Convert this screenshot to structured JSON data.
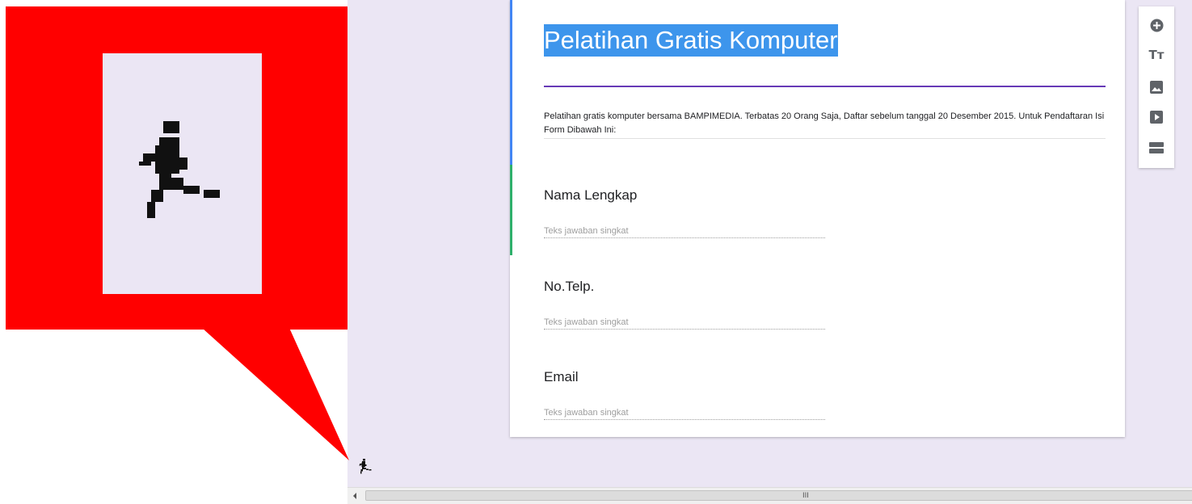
{
  "form": {
    "title": "Pelatihan Gratis Komputer",
    "description": "Pelatihan gratis komputer bersama BAMPIMEDIA. Terbatas 20 Orang Saja, Daftar sebelum tanggal 20 Desember 2015. Untuk Pendaftaran Isi Form Dibawah Ini:",
    "questions": [
      {
        "title": "Nama Lengkap",
        "placeholder": "Teks jawaban singkat"
      },
      {
        "title": "No.Telp.",
        "placeholder": "Teks jawaban singkat"
      },
      {
        "title": "Email",
        "placeholder": "Teks jawaban singkat"
      }
    ]
  },
  "toolbar": {
    "items": [
      {
        "icon": "add-circle-icon"
      },
      {
        "icon": "title-text-icon",
        "label": "Tт"
      },
      {
        "icon": "image-icon"
      },
      {
        "icon": "video-icon"
      },
      {
        "icon": "section-icon"
      }
    ]
  },
  "scrollbar": {
    "grip": "III"
  },
  "colors": {
    "callout": "#ff0000",
    "background": "#ebe6f4",
    "title_highlight": "#3d95ec",
    "title_rule": "#673ab7",
    "accent_blue": "#4285f4",
    "accent_green": "#2eb06b"
  },
  "annotation": {
    "icon": "running-man-icon"
  }
}
